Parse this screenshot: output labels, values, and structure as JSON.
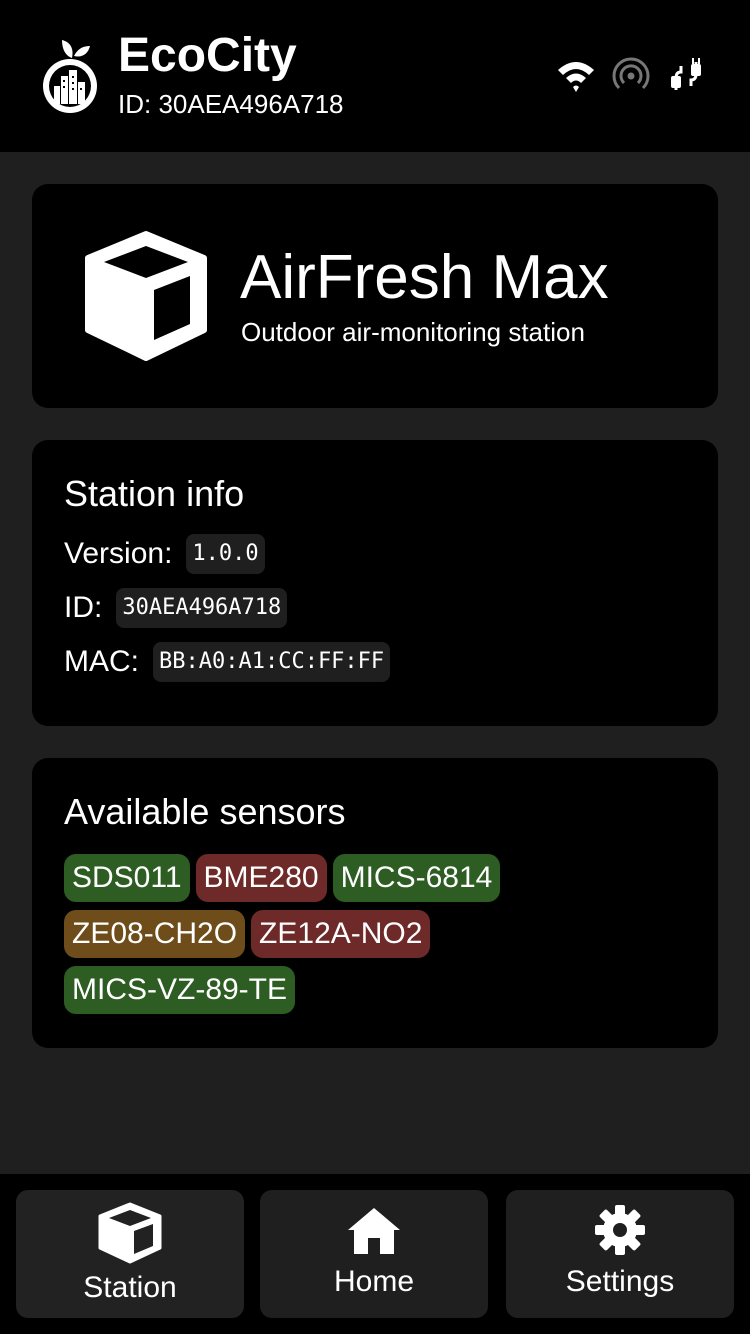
{
  "header": {
    "title": "EcoCity",
    "device_id": "ID: 30AEA496A718",
    "icons": [
      "logo-icon",
      "wifi-icon",
      "broadcast-icon",
      "cable-icon"
    ]
  },
  "product": {
    "name": "AirFresh Max",
    "description": "Outdoor air-monitoring station",
    "icon": "cube-icon"
  },
  "station_info": {
    "title": "Station info",
    "rows": [
      {
        "label": "Version:",
        "value": "1.0.0"
      },
      {
        "label": "ID:",
        "value": "30AEA496A718"
      },
      {
        "label": "MAC:",
        "value": "BB:A0:A1:CC:FF:FF"
      }
    ]
  },
  "sensors": {
    "title": "Available sensors",
    "items": [
      {
        "name": "SDS011",
        "status": "green"
      },
      {
        "name": "BME280",
        "status": "red"
      },
      {
        "name": "MICS-6814",
        "status": "green"
      },
      {
        "name": "ZE08-CH2O",
        "status": "brown"
      },
      {
        "name": "ZE12A-NO2",
        "status": "red"
      },
      {
        "name": "MICS-VZ-89-TE",
        "status": "green"
      }
    ],
    "colors": {
      "green": "#2d5d23",
      "red": "#6d2a28",
      "brown": "#6e4d1b"
    }
  },
  "nav": {
    "items": [
      {
        "label": "Station",
        "icon": "cube-icon",
        "active": true
      },
      {
        "label": "Home",
        "icon": "home-icon",
        "active": false
      },
      {
        "label": "Settings",
        "icon": "gear-icon",
        "active": false
      }
    ]
  }
}
